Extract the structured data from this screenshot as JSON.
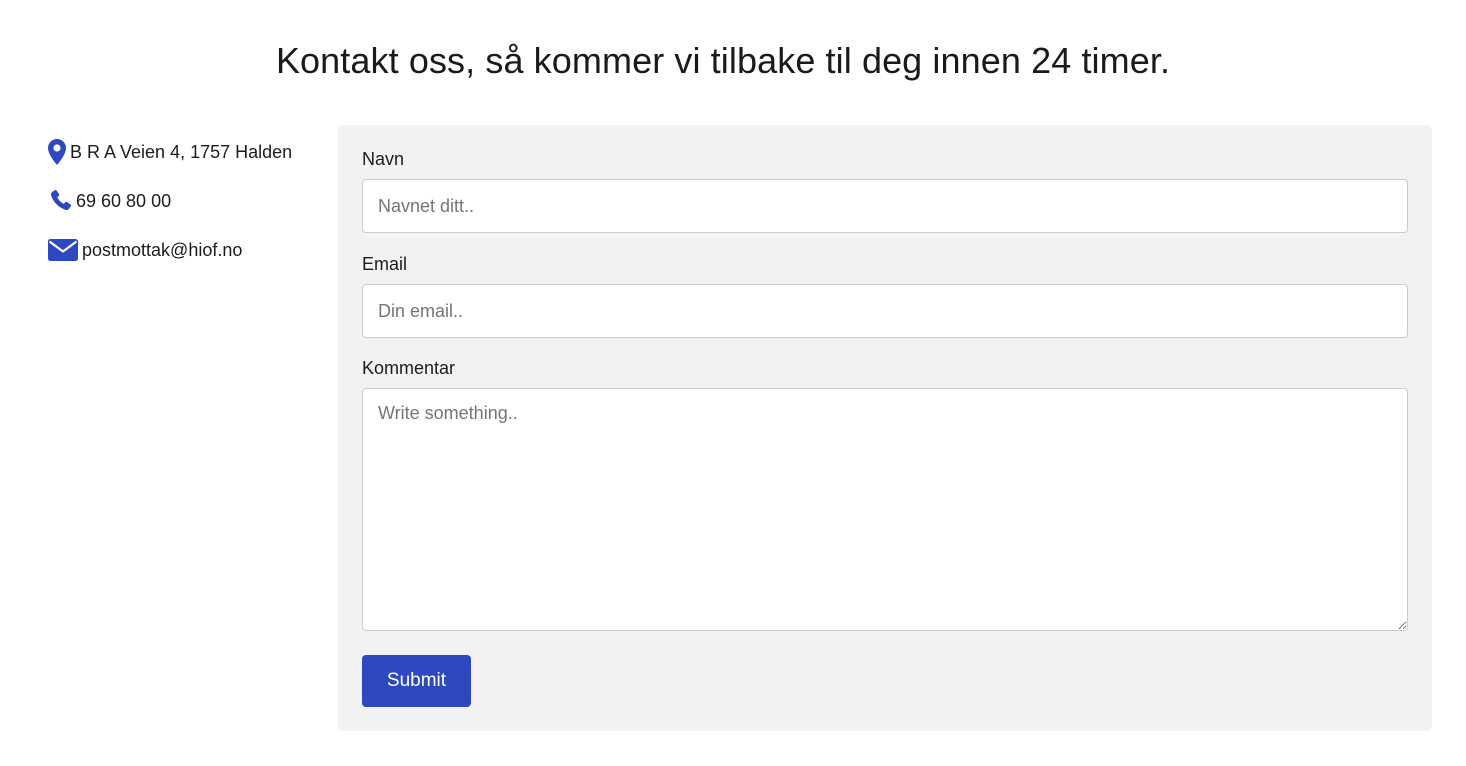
{
  "page": {
    "heading": "Kontakt oss, så kommer vi tilbake til deg innen 24 timer."
  },
  "contact": {
    "address": "B R A Veien 4, 1757 Halden",
    "phone": "69 60 80 00",
    "email": "postmottak@hiof.no",
    "icons": [
      "map-marker-icon",
      "phone-icon",
      "envelope-icon"
    ]
  },
  "form": {
    "name_label": "Navn",
    "name_placeholder": "Navnet ditt..",
    "name_value": "",
    "email_label": "Email",
    "email_placeholder": "Din email..",
    "email_value": "",
    "comment_label": "Kommentar",
    "comment_placeholder": "Write something..",
    "comment_value": "",
    "submit_label": "Submit"
  },
  "colors": {
    "accent": "#2e48bf",
    "panel_background": "#f2f2f2",
    "input_border": "#cccccc"
  }
}
